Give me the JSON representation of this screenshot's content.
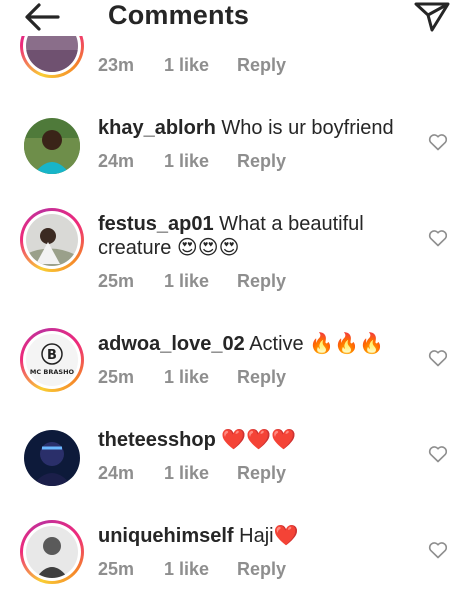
{
  "header": {
    "title": "Comments",
    "back_icon": "arrow-left-icon",
    "share_icon": "paper-plane-icon"
  },
  "comments": [
    {
      "username": "",
      "text": "",
      "time": "23m",
      "likes": "1 like",
      "reply": "Reply"
    },
    {
      "username": "khay_ablorh",
      "text": " Who is ur boyfriend",
      "time": "24m",
      "likes": "1 like",
      "reply": "Reply"
    },
    {
      "username": "festus_ap01",
      "text": " What a beautiful creature 😍😍😍",
      "time": "25m",
      "likes": "1 like",
      "reply": "Reply"
    },
    {
      "username": "adwoa_love_02",
      "text": " Active 🔥🔥🔥",
      "time": "25m",
      "likes": "1 like",
      "reply": "Reply"
    },
    {
      "username": "theteesshop",
      "text": " ❤️❤️❤️",
      "time": "24m",
      "likes": "1 like",
      "reply": "Reply"
    },
    {
      "username": "uniquehimself",
      "text": " Haji❤️",
      "time": "25m",
      "likes": "1 like",
      "reply": "Reply"
    }
  ],
  "avatar_logo": {
    "letter": "B",
    "name": "MC BRASHO"
  },
  "colors": {
    "text": "#262626",
    "meta": "#8e8e8e",
    "ring_start": "#f9ce34",
    "ring_end": "#ee2a7b"
  }
}
